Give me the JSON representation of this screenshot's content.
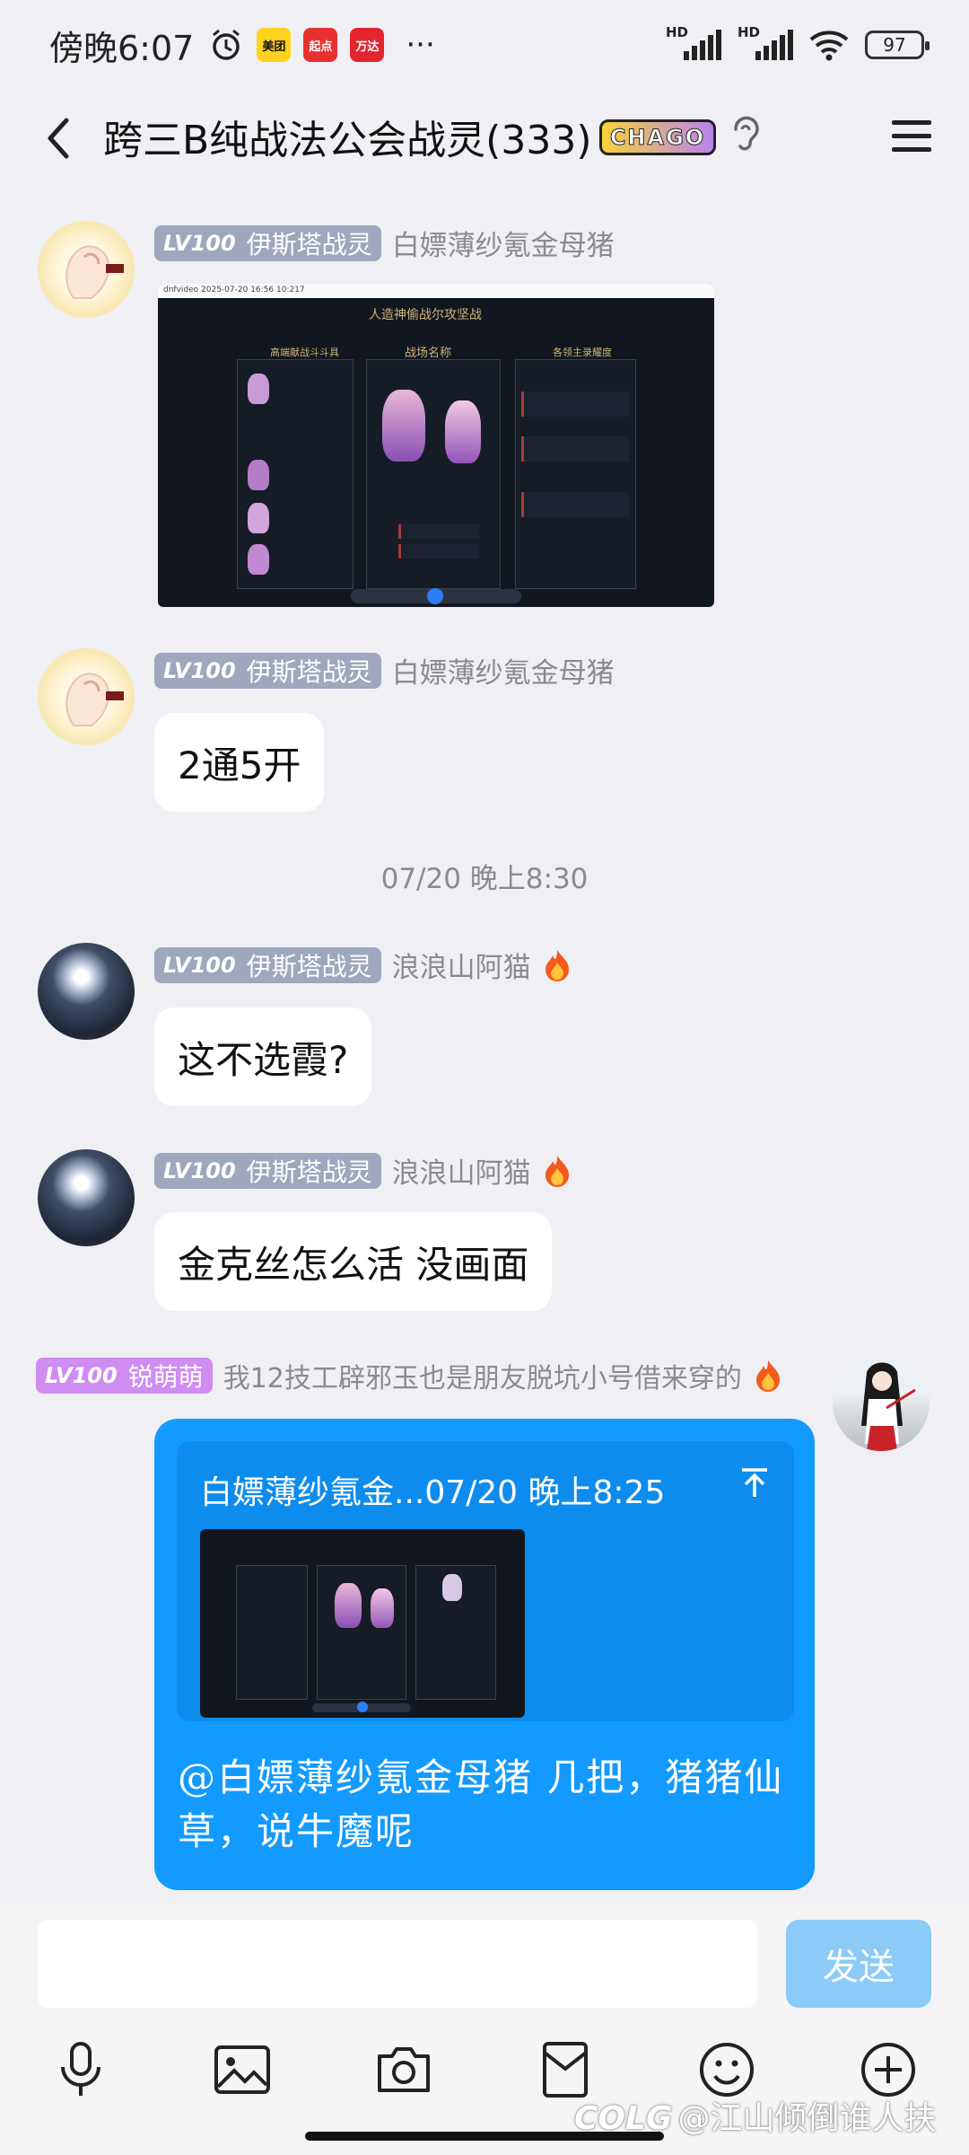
{
  "status_bar": {
    "time": "傍晚6:07",
    "app_badges": [
      "美团",
      "起点",
      "万达"
    ],
    "more": "···",
    "net1": "HD",
    "net2": "HD",
    "battery": "97"
  },
  "header": {
    "title": "跨三B纯战法公会战灵(333)",
    "badge": "CHAGO"
  },
  "messages": [
    {
      "lv": "LV100",
      "title": "伊斯塔战灵",
      "name": "白嫖薄纱氪金母猪",
      "type": "image",
      "image": {
        "window_title": "dnfvideo 2025-07-20 16:56 10:217",
        "heading": "人造神偷战尔攻坚战",
        "sub": "战场名称",
        "left_col": "高端献战斗斗具",
        "right_col": "各领主录耀度"
      }
    },
    {
      "lv": "LV100",
      "title": "伊斯塔战灵",
      "name": "白嫖薄纱氪金母猪",
      "type": "text",
      "text": "2通5开"
    },
    {
      "lv": "LV100",
      "title": "伊斯塔战灵",
      "name": "浪浪山阿猫",
      "type": "text",
      "text": "这不选霞?"
    },
    {
      "lv": "LV100",
      "title": "伊斯塔战灵",
      "name": "浪浪山阿猫",
      "type": "text",
      "text": "金克丝怎么活 没画面"
    }
  ],
  "timestamp": "07/20 晚上8:30",
  "self_message": {
    "lv": "LV100",
    "name": "锐萌萌",
    "title": "我12技工辟邪玉也是朋友脱坑小号借来穿的",
    "quote_header": "白嫖薄纱氪金...07/20 晚上8:25",
    "reply_text": "@白嫖薄纱氪金母猪 几把，猪猪仙草，说牛魔呢"
  },
  "input": {
    "placeholder": "",
    "send_label": "发送"
  },
  "watermark": "@江山倾倒谁人扶",
  "watermark_logo": "COLG"
}
